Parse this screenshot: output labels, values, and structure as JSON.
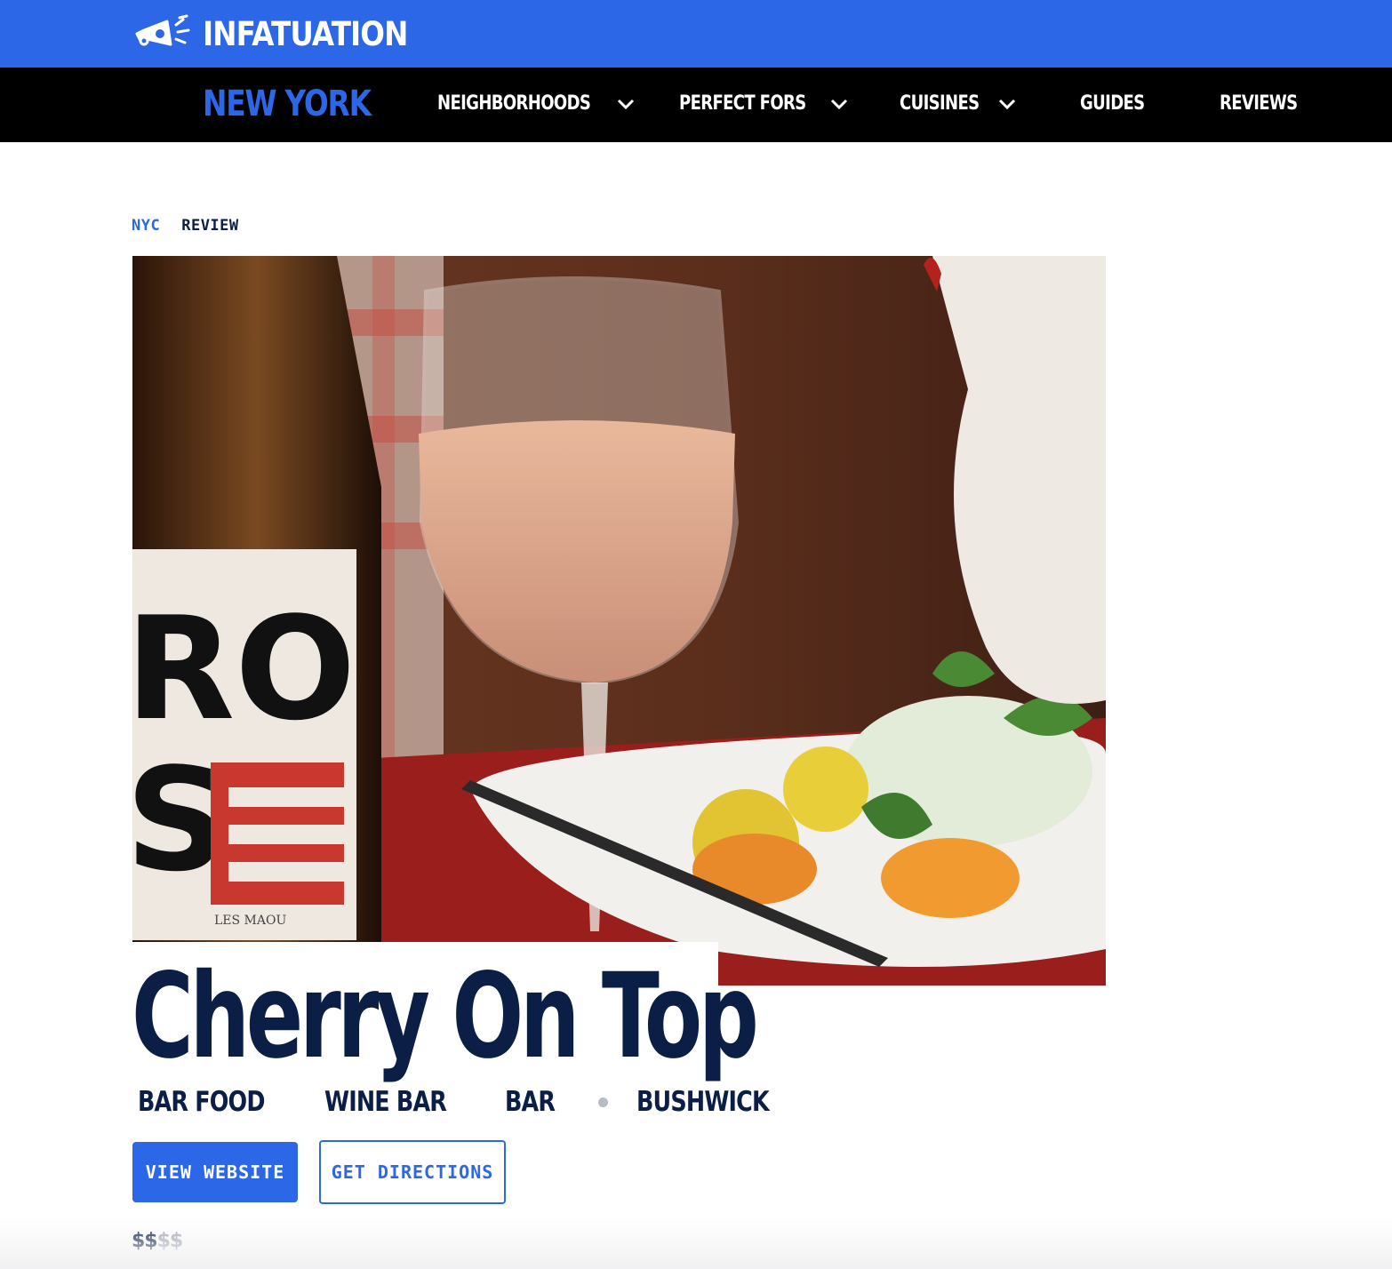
{
  "brand": {
    "name": "INFATUATION",
    "logo_icon": "megaphone-icon",
    "color": "#2b67e6"
  },
  "nav": {
    "city": "NEW YORK",
    "items": [
      {
        "label": "NEIGHBORHOODS",
        "has_dropdown": true
      },
      {
        "label": "PERFECT FORS",
        "has_dropdown": true
      },
      {
        "label": "CUISINES",
        "has_dropdown": true
      },
      {
        "label": "GUIDES",
        "has_dropdown": false
      },
      {
        "label": "REVIEWS",
        "has_dropdown": false
      }
    ]
  },
  "breadcrumb": {
    "city": "NYC",
    "section": "REVIEW"
  },
  "hero": {
    "bottle_label_text": "ROSÉ",
    "bottle_sublabel": "LES MAOU"
  },
  "restaurant": {
    "name": "Cherry On Top",
    "tags": [
      "BAR FOOD",
      "WINE BAR",
      "BAR"
    ],
    "neighborhood": "BUSHWICK",
    "price_filled": "$$",
    "price_empty": "$$"
  },
  "actions": {
    "website_label": "VIEW WEBSITE",
    "directions_label": "GET DIRECTIONS"
  },
  "colors": {
    "primary_blue": "#2b67e6",
    "navy": "#0b1e46",
    "nav_bg": "#000000"
  }
}
